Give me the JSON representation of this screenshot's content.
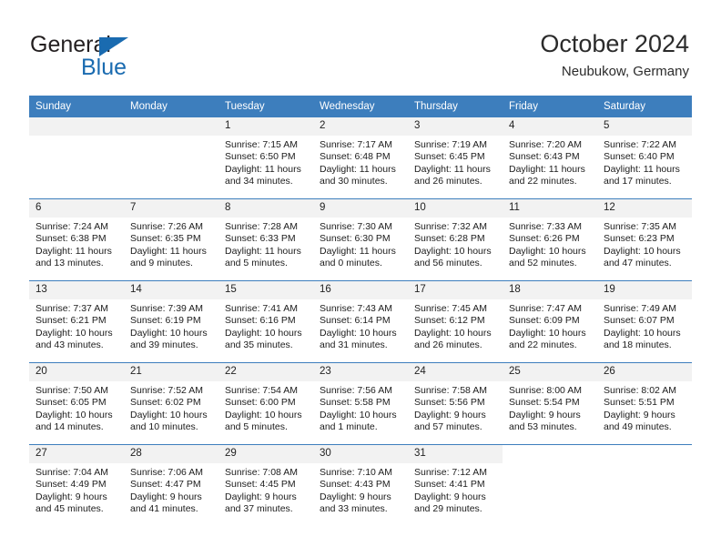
{
  "brand": {
    "name_part1": "General",
    "name_part2": "Blue",
    "flag_icon": "blue-triangle-flag-icon",
    "accent_color": "#1a6bb0"
  },
  "header": {
    "title": "October 2024",
    "subtitle": "Neubukow, Germany"
  },
  "calendar": {
    "header_bg": "#3d7ebd",
    "datebar_bg": "#f2f2f2",
    "weekdays": [
      "Sunday",
      "Monday",
      "Tuesday",
      "Wednesday",
      "Thursday",
      "Friday",
      "Saturday"
    ],
    "weeks": [
      [
        {
          "date": "",
          "sunrise": "",
          "sunset": "",
          "daylight": "",
          "empty": true
        },
        {
          "date": "",
          "sunrise": "",
          "sunset": "",
          "daylight": "",
          "empty": true
        },
        {
          "date": "1",
          "sunrise": "Sunrise: 7:15 AM",
          "sunset": "Sunset: 6:50 PM",
          "daylight": "Daylight: 11 hours and 34 minutes."
        },
        {
          "date": "2",
          "sunrise": "Sunrise: 7:17 AM",
          "sunset": "Sunset: 6:48 PM",
          "daylight": "Daylight: 11 hours and 30 minutes."
        },
        {
          "date": "3",
          "sunrise": "Sunrise: 7:19 AM",
          "sunset": "Sunset: 6:45 PM",
          "daylight": "Daylight: 11 hours and 26 minutes."
        },
        {
          "date": "4",
          "sunrise": "Sunrise: 7:20 AM",
          "sunset": "Sunset: 6:43 PM",
          "daylight": "Daylight: 11 hours and 22 minutes."
        },
        {
          "date": "5",
          "sunrise": "Sunrise: 7:22 AM",
          "sunset": "Sunset: 6:40 PM",
          "daylight": "Daylight: 11 hours and 17 minutes."
        }
      ],
      [
        {
          "date": "6",
          "sunrise": "Sunrise: 7:24 AM",
          "sunset": "Sunset: 6:38 PM",
          "daylight": "Daylight: 11 hours and 13 minutes."
        },
        {
          "date": "7",
          "sunrise": "Sunrise: 7:26 AM",
          "sunset": "Sunset: 6:35 PM",
          "daylight": "Daylight: 11 hours and 9 minutes."
        },
        {
          "date": "8",
          "sunrise": "Sunrise: 7:28 AM",
          "sunset": "Sunset: 6:33 PM",
          "daylight": "Daylight: 11 hours and 5 minutes."
        },
        {
          "date": "9",
          "sunrise": "Sunrise: 7:30 AM",
          "sunset": "Sunset: 6:30 PM",
          "daylight": "Daylight: 11 hours and 0 minutes."
        },
        {
          "date": "10",
          "sunrise": "Sunrise: 7:32 AM",
          "sunset": "Sunset: 6:28 PM",
          "daylight": "Daylight: 10 hours and 56 minutes."
        },
        {
          "date": "11",
          "sunrise": "Sunrise: 7:33 AM",
          "sunset": "Sunset: 6:26 PM",
          "daylight": "Daylight: 10 hours and 52 minutes."
        },
        {
          "date": "12",
          "sunrise": "Sunrise: 7:35 AM",
          "sunset": "Sunset: 6:23 PM",
          "daylight": "Daylight: 10 hours and 47 minutes."
        }
      ],
      [
        {
          "date": "13",
          "sunrise": "Sunrise: 7:37 AM",
          "sunset": "Sunset: 6:21 PM",
          "daylight": "Daylight: 10 hours and 43 minutes."
        },
        {
          "date": "14",
          "sunrise": "Sunrise: 7:39 AM",
          "sunset": "Sunset: 6:19 PM",
          "daylight": "Daylight: 10 hours and 39 minutes."
        },
        {
          "date": "15",
          "sunrise": "Sunrise: 7:41 AM",
          "sunset": "Sunset: 6:16 PM",
          "daylight": "Daylight: 10 hours and 35 minutes."
        },
        {
          "date": "16",
          "sunrise": "Sunrise: 7:43 AM",
          "sunset": "Sunset: 6:14 PM",
          "daylight": "Daylight: 10 hours and 31 minutes."
        },
        {
          "date": "17",
          "sunrise": "Sunrise: 7:45 AM",
          "sunset": "Sunset: 6:12 PM",
          "daylight": "Daylight: 10 hours and 26 minutes."
        },
        {
          "date": "18",
          "sunrise": "Sunrise: 7:47 AM",
          "sunset": "Sunset: 6:09 PM",
          "daylight": "Daylight: 10 hours and 22 minutes."
        },
        {
          "date": "19",
          "sunrise": "Sunrise: 7:49 AM",
          "sunset": "Sunset: 6:07 PM",
          "daylight": "Daylight: 10 hours and 18 minutes."
        }
      ],
      [
        {
          "date": "20",
          "sunrise": "Sunrise: 7:50 AM",
          "sunset": "Sunset: 6:05 PM",
          "daylight": "Daylight: 10 hours and 14 minutes."
        },
        {
          "date": "21",
          "sunrise": "Sunrise: 7:52 AM",
          "sunset": "Sunset: 6:02 PM",
          "daylight": "Daylight: 10 hours and 10 minutes."
        },
        {
          "date": "22",
          "sunrise": "Sunrise: 7:54 AM",
          "sunset": "Sunset: 6:00 PM",
          "daylight": "Daylight: 10 hours and 5 minutes."
        },
        {
          "date": "23",
          "sunrise": "Sunrise: 7:56 AM",
          "sunset": "Sunset: 5:58 PM",
          "daylight": "Daylight: 10 hours and 1 minute."
        },
        {
          "date": "24",
          "sunrise": "Sunrise: 7:58 AM",
          "sunset": "Sunset: 5:56 PM",
          "daylight": "Daylight: 9 hours and 57 minutes."
        },
        {
          "date": "25",
          "sunrise": "Sunrise: 8:00 AM",
          "sunset": "Sunset: 5:54 PM",
          "daylight": "Daylight: 9 hours and 53 minutes."
        },
        {
          "date": "26",
          "sunrise": "Sunrise: 8:02 AM",
          "sunset": "Sunset: 5:51 PM",
          "daylight": "Daylight: 9 hours and 49 minutes."
        }
      ],
      [
        {
          "date": "27",
          "sunrise": "Sunrise: 7:04 AM",
          "sunset": "Sunset: 4:49 PM",
          "daylight": "Daylight: 9 hours and 45 minutes."
        },
        {
          "date": "28",
          "sunrise": "Sunrise: 7:06 AM",
          "sunset": "Sunset: 4:47 PM",
          "daylight": "Daylight: 9 hours and 41 minutes."
        },
        {
          "date": "29",
          "sunrise": "Sunrise: 7:08 AM",
          "sunset": "Sunset: 4:45 PM",
          "daylight": "Daylight: 9 hours and 37 minutes."
        },
        {
          "date": "30",
          "sunrise": "Sunrise: 7:10 AM",
          "sunset": "Sunset: 4:43 PM",
          "daylight": "Daylight: 9 hours and 33 minutes."
        },
        {
          "date": "31",
          "sunrise": "Sunrise: 7:12 AM",
          "sunset": "Sunset: 4:41 PM",
          "daylight": "Daylight: 9 hours and 29 minutes."
        },
        {
          "date": "",
          "sunrise": "",
          "sunset": "",
          "daylight": "",
          "blank": true
        },
        {
          "date": "",
          "sunrise": "",
          "sunset": "",
          "daylight": "",
          "blank": true
        }
      ]
    ]
  }
}
